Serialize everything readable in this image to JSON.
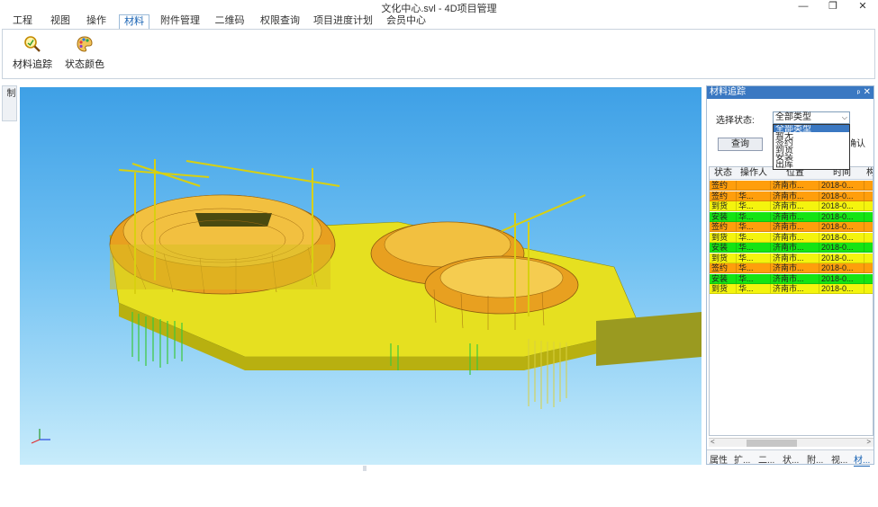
{
  "window": {
    "title": "文化中心.svl - 4D项目管理",
    "minimize": "—",
    "restore": "❐",
    "close": "✕"
  },
  "menu": {
    "items": [
      "工程",
      "视图",
      "操作",
      "材料",
      "附件管理",
      "二维码",
      "权限查询",
      "项目进度计划",
      "会员中心"
    ],
    "active": "材料"
  },
  "ribbon": {
    "buttons": [
      {
        "label": "材料追踪",
        "icon": "magnifier-icon"
      },
      {
        "label": "状态颜色",
        "icon": "palette-icon"
      }
    ]
  },
  "sidebar": {
    "label": "显示控制"
  },
  "panel": {
    "title": "材料追踪",
    "pin": "ᵖ",
    "close": "✕",
    "state_label": "选择状态:",
    "combo_value": "全部类型",
    "combo_arrow": "⌵",
    "dropdown": [
      "全部类型",
      "暂无",
      "签约",
      "到货",
      "安装",
      "出库"
    ],
    "query_button": "查询",
    "confirm_button": "确认",
    "columns": [
      "状态",
      "操作人",
      "位置",
      "时间",
      "构"
    ],
    "status_colors": {
      "签约": "#ff9e0c",
      "到货": "#f4f40e",
      "安装": "#14e414"
    },
    "rows": [
      {
        "status": "签约",
        "operator": "",
        "location": "济南市...",
        "time": "2018-0..."
      },
      {
        "status": "签约",
        "operator": "华...",
        "location": "济南市...",
        "time": "2018-0..."
      },
      {
        "status": "到货",
        "operator": "华...",
        "location": "济南市...",
        "time": "2018-0..."
      },
      {
        "status": "安装",
        "operator": "华...",
        "location": "济南市...",
        "time": "2018-0..."
      },
      {
        "status": "签约",
        "operator": "华...",
        "location": "济南市...",
        "time": "2018-0..."
      },
      {
        "status": "到货",
        "operator": "华...",
        "location": "济南市...",
        "time": "2018-0..."
      },
      {
        "status": "安装",
        "operator": "华...",
        "location": "济南市...",
        "time": "2018-0..."
      },
      {
        "status": "到货",
        "operator": "华...",
        "location": "济南市...",
        "time": "2018-0..."
      },
      {
        "status": "签约",
        "operator": "华...",
        "location": "济南市...",
        "time": "2018-0..."
      },
      {
        "status": "安装",
        "operator": "华...",
        "location": "济南市...",
        "time": "2018-0..."
      },
      {
        "status": "到货",
        "operator": "华...",
        "location": "济南市...",
        "time": "2018-0..."
      }
    ],
    "bottom_tabs": [
      "属性",
      "扩...",
      "二...",
      "状...",
      "附...",
      "视...",
      "材..."
    ],
    "active_tab": "材..."
  },
  "colors": {
    "accent": "#3a78c2",
    "model_yellow": "#f0e020",
    "model_orange": "#e8a020",
    "pile_green": "#3cc83c"
  }
}
